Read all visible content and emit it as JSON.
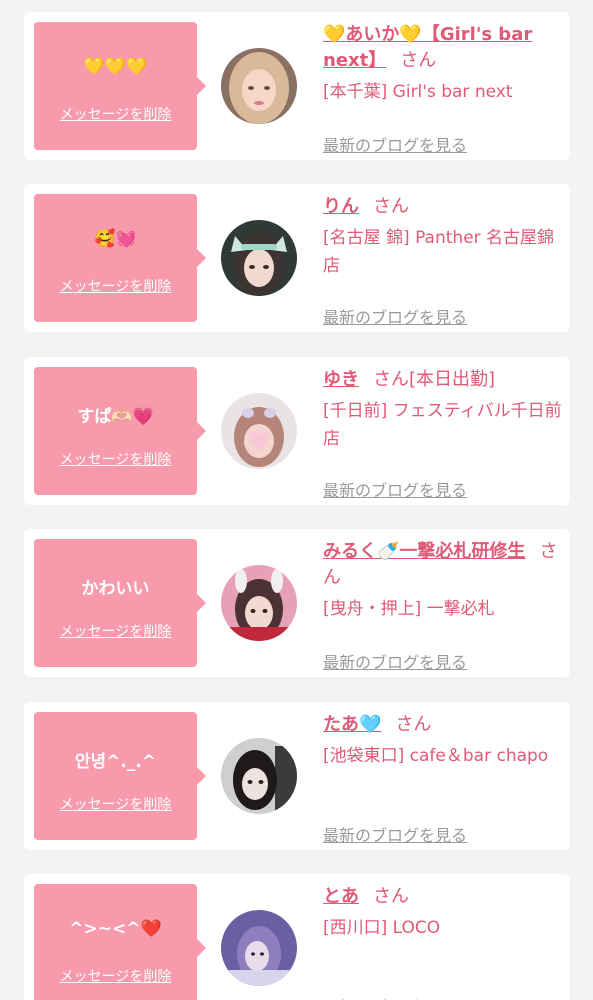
{
  "delete_label": "メッセージを削除",
  "blog_label": "最新のブログを見る",
  "san_suffix": "さん",
  "colors": {
    "bubble": "#f79aac",
    "accent": "#e05a77",
    "link_gray": "#9a9a9a",
    "background": "#f3f3f3"
  },
  "messages": [
    {
      "message": "💛💛💛",
      "name": "💛あいか💛【Girl's bar next】",
      "extra": "",
      "shop": "[本千葉] Girl's bar next",
      "avatar": "photo-woman-blonde"
    },
    {
      "message": "🥰💓",
      "name": "りん",
      "extra": "",
      "shop": "[名古屋 錦] Panther 名古屋錦店",
      "avatar": "photo-woman-cat-ears"
    },
    {
      "message": "すぱ🫶🏻💗",
      "name": "ゆき",
      "extra": "[本日出勤]",
      "shop": "[千日前] フェスティバル千日前店",
      "avatar": "photo-woman-heart-face"
    },
    {
      "message": "かわいい",
      "name": "みるく🍼一撃必札研修生",
      "extra": "",
      "shop": "[曳舟・押上] 一撃必札",
      "avatar": "photo-woman-bunny-ears"
    },
    {
      "message": "안녕^._.^",
      "name": "たあ🩵",
      "extra": "",
      "shop": "[池袋東口] cafe＆bar chapo",
      "avatar": "photo-woman-dark-hair"
    },
    {
      "message": "^>~<^❤️",
      "name": "とあ",
      "extra": "",
      "shop": "[西川口] LOCO",
      "avatar": "photo-woman-purple"
    }
  ]
}
